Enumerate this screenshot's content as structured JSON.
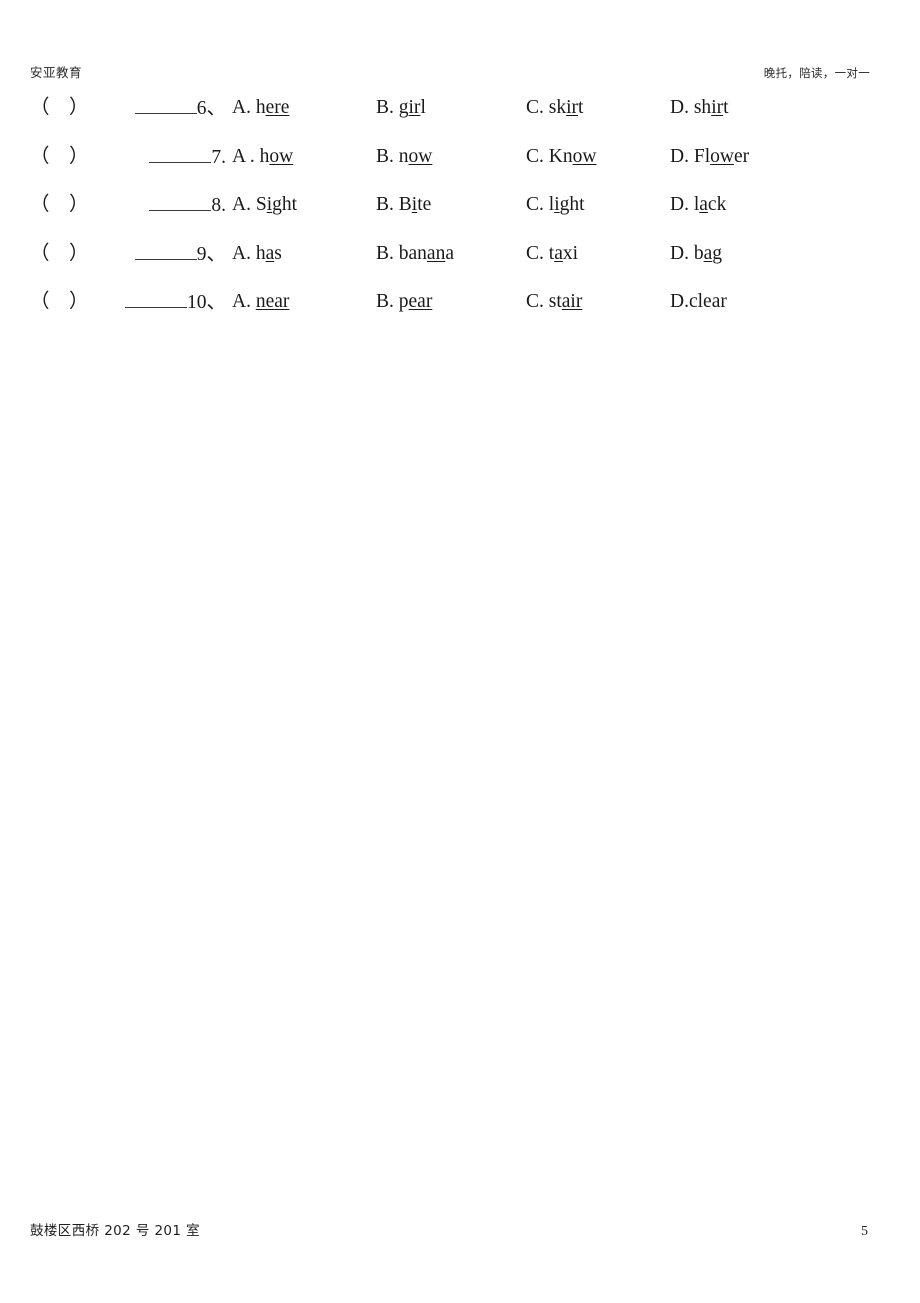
{
  "header": {
    "left_text": "安亚教育",
    "right_text": "晚托，陪读，一对一"
  },
  "footer": {
    "address": "鼓楼区西桥 202 号 201 室",
    "page_number": "5"
  },
  "questions": [
    {
      "paren": "（    ）",
      "number": "6、",
      "options": {
        "a": {
          "letter": "A. ",
          "pre": "h",
          "underlined": "ere",
          "post": ""
        },
        "b": {
          "letter": "B. ",
          "pre": "g",
          "underlined": "ir",
          "post": "l"
        },
        "c": {
          "letter": "C. ",
          "pre": "sk",
          "underlined": "ir",
          "post": "t"
        },
        "d": {
          "letter": "D. ",
          "pre": "sh",
          "underlined": "ir",
          "post": "t"
        }
      }
    },
    {
      "paren": "（    ）",
      "number": "7.",
      "options": {
        "a": {
          "letter": "A . ",
          "pre": "h",
          "underlined": "ow",
          "post": ""
        },
        "b": {
          "letter": "B. ",
          "pre": "n",
          "underlined": "ow",
          "post": ""
        },
        "c": {
          "letter": "C. ",
          "pre": "Kn",
          "underlined": "ow",
          "post": ""
        },
        "d": {
          "letter": "D. ",
          "pre": "Fl",
          "underlined": "ow",
          "post": "er"
        }
      }
    },
    {
      "paren": "（    ）",
      "number": "8.",
      "options": {
        "a": {
          "letter": "A. ",
          "pre": "S",
          "underlined": "i",
          "post": "ght"
        },
        "b": {
          "letter": "B. ",
          "pre": "B",
          "underlined": "i",
          "post": "te"
        },
        "c": {
          "letter": "C. ",
          "pre": "l",
          "underlined": "i",
          "post": "ght"
        },
        "d": {
          "letter": "D. ",
          "pre": "l",
          "underlined": "a",
          "post": "ck"
        }
      }
    },
    {
      "paren": "（    ）",
      "number": "9、",
      "options": {
        "a": {
          "letter": "A. ",
          "pre": "h",
          "underlined": "a",
          "post": "s"
        },
        "b": {
          "letter": "B. ",
          "pre": "ban",
          "underlined": "an",
          "post": "a"
        },
        "c": {
          "letter": "C. ",
          "pre": "t",
          "underlined": "a",
          "post": "xi"
        },
        "d": {
          "letter": "D. ",
          "pre": "b",
          "underlined": "a",
          "post": "g"
        }
      }
    },
    {
      "paren": "（    ）",
      "number": "10、",
      "options": {
        "a": {
          "letter": "A. ",
          "pre": "",
          "underlined": "near",
          "post": ""
        },
        "b": {
          "letter": "B. ",
          "pre": "p",
          "underlined": "ear",
          "post": ""
        },
        "c": {
          "letter": "C. ",
          "pre": "st",
          "underlined": "air",
          "post": ""
        },
        "d": {
          "letter": "D.",
          "pre": "clear",
          "underlined": "",
          "post": ""
        }
      }
    }
  ]
}
